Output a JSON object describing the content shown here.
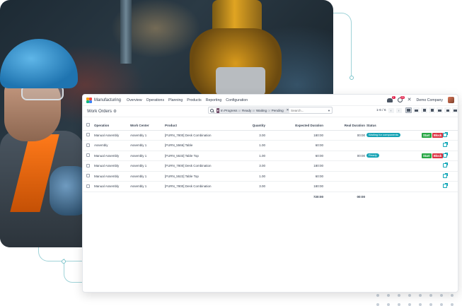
{
  "navbar": {
    "app_title": "Manufacturing",
    "menu": [
      "Overview",
      "Operations",
      "Planning",
      "Products",
      "Reporting",
      "Configuration"
    ],
    "messages_badge": "2",
    "activities_badge": "20",
    "company": "Demo Company"
  },
  "control": {
    "breadcrumb": "Work Orders",
    "facet": {
      "parts": [
        "In Progress",
        "or",
        "Ready",
        "or",
        "Waiting",
        "or",
        "Pending"
      ]
    },
    "search_placeholder": "Search...",
    "pager": "1-6 / 6"
  },
  "table": {
    "columns": [
      "Operation",
      "Work Center",
      "Product",
      "Quantity",
      "Expected Duration",
      "Real Duration",
      "Status"
    ],
    "rows": [
      {
        "operation": "Manual Assembly",
        "work_center": "Assembly 1",
        "product": "[FURN_7800] Desk Combination",
        "quantity": "3.00",
        "expected": "180:00",
        "real": "00:00",
        "status": "Waiting for components",
        "status_color": "#16a3b5",
        "actions": true
      },
      {
        "operation": "Assembly",
        "work_center": "Assembly 1",
        "product": "[FURN_5566] Table",
        "quantity": "1.00",
        "expected": "60:00",
        "real": "",
        "status": "",
        "status_color": "",
        "actions": false
      },
      {
        "operation": "Manual Assembly",
        "work_center": "Assembly 1",
        "product": "[FURN_5533] Table Top",
        "quantity": "1.00",
        "expected": "60:00",
        "real": "00:00",
        "status": "Ready",
        "status_color": "#16a3b5",
        "actions": true
      },
      {
        "operation": "Manual Assembly",
        "work_center": "Assembly 1",
        "product": "[FURN_7800] Desk Combination",
        "quantity": "3.00",
        "expected": "180:00",
        "real": "",
        "status": "",
        "status_color": "",
        "actions": false
      },
      {
        "operation": "Manual Assembly",
        "work_center": "Assembly 1",
        "product": "[FURN_5522] Table Top",
        "quantity": "1.00",
        "expected": "60:00",
        "real": "",
        "status": "",
        "status_color": "",
        "actions": false
      },
      {
        "operation": "Manual Assembly",
        "work_center": "Assembly 1",
        "product": "[FURN_7800] Desk Combination",
        "quantity": "3.00",
        "expected": "180:00",
        "real": "",
        "status": "",
        "status_color": "",
        "actions": false
      }
    ],
    "totals": {
      "expected": "720:00",
      "real": "00:00"
    },
    "start_label": "Start",
    "block_label": "Block",
    "colors": {
      "start": "#28a745",
      "block": "#dc3545",
      "accent": "#714b67"
    }
  }
}
